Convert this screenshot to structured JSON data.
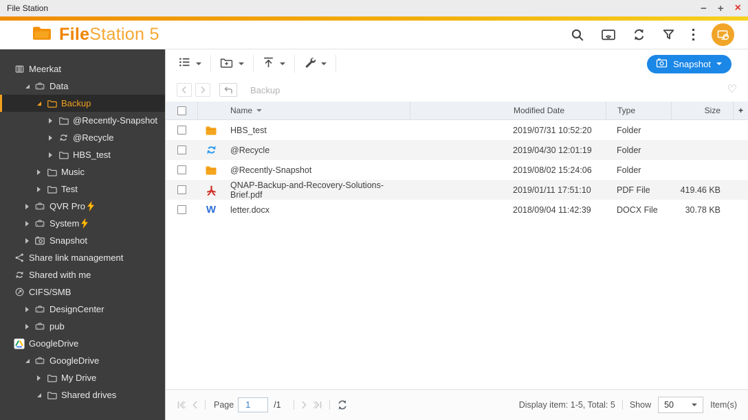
{
  "window": {
    "title": "File Station",
    "minimize": "−",
    "maximize": "+",
    "close": "×"
  },
  "header": {
    "logo_bold": "File",
    "logo_light": "Station 5"
  },
  "sidebar": {
    "items": [
      {
        "label": "Meerkat",
        "icon": "nas",
        "level": 0,
        "arrow": "none"
      },
      {
        "label": "Data",
        "icon": "drive",
        "level": 1,
        "arrow": "exp"
      },
      {
        "label": "Backup",
        "icon": "folder",
        "level": 2,
        "arrow": "exp",
        "selected": true
      },
      {
        "label": "@Recently-Snapshot",
        "icon": "folder",
        "level": 3,
        "arrow": "col"
      },
      {
        "label": "@Recycle",
        "icon": "sync",
        "level": 3,
        "arrow": "col"
      },
      {
        "label": "HBS_test",
        "icon": "folder",
        "level": 3,
        "arrow": "col"
      },
      {
        "label": "Music",
        "icon": "folder",
        "level": 2,
        "arrow": "col"
      },
      {
        "label": "Test",
        "icon": "folder",
        "level": 2,
        "arrow": "col"
      },
      {
        "label": "QVR Pro",
        "icon": "drive",
        "level": 1,
        "arrow": "col",
        "bolt": true
      },
      {
        "label": "System",
        "icon": "drive",
        "level": 1,
        "arrow": "col",
        "bolt": true
      },
      {
        "label": "Snapshot",
        "icon": "camera",
        "level": 1,
        "arrow": "col"
      },
      {
        "label": "Share link management",
        "icon": "share",
        "level": 0,
        "arrow": "none"
      },
      {
        "label": "Shared with me",
        "icon": "sync",
        "level": 0,
        "arrow": "none"
      },
      {
        "label": "CIFS/SMB",
        "icon": "network",
        "level": 0,
        "arrow": "none"
      },
      {
        "label": "DesignCenter",
        "icon": "drive",
        "level": 1,
        "arrow": "col"
      },
      {
        "label": "pub",
        "icon": "drive",
        "level": 1,
        "arrow": "col"
      },
      {
        "label": "GoogleDrive",
        "icon": "gdrive",
        "level": 0,
        "arrow": "none"
      },
      {
        "label": "GoogleDrive",
        "icon": "drive",
        "level": 1,
        "arrow": "exp"
      },
      {
        "label": "My Drive",
        "icon": "folder",
        "level": 2,
        "arrow": "col"
      },
      {
        "label": "Shared drives",
        "icon": "folder",
        "level": 2,
        "arrow": "exp"
      }
    ]
  },
  "toolbar": {
    "snapshot_label": "Snapshot"
  },
  "breadcrumb": {
    "path": "Backup"
  },
  "table": {
    "columns": {
      "name": "Name",
      "modified": "Modified Date",
      "type": "Type",
      "size": "Size",
      "add": "+"
    },
    "rows": [
      {
        "name": "HBS_test",
        "icon": "folder-fill",
        "modified": "2019/07/31 10:52:20",
        "type": "Folder",
        "size": ""
      },
      {
        "name": "@Recycle",
        "icon": "recycle-fill",
        "modified": "2019/04/30 12:01:19",
        "type": "Folder",
        "size": ""
      },
      {
        "name": "@Recently-Snapshot",
        "icon": "folder-fill",
        "modified": "2019/08/02 15:24:06",
        "type": "Folder",
        "size": ""
      },
      {
        "name": "QNAP-Backup-and-Recovery-Solutions-Brief.pdf",
        "icon": "pdf",
        "modified": "2019/01/11 17:51:10",
        "type": "PDF File",
        "size": "419.46 KB"
      },
      {
        "name": "letter.docx",
        "icon": "word",
        "modified": "2018/09/04 11:42:39",
        "type": "DOCX File",
        "size": "30.78 KB"
      }
    ]
  },
  "footer": {
    "page_label": "Page",
    "page_value": "1",
    "page_total": "/1",
    "display_text": "Display item: 1-5, Total: 5",
    "show_label": "Show",
    "page_size": "50",
    "items_label": "Item(s)"
  },
  "colors": {
    "accent_orange": "#f29104",
    "selected_orange": "#f0a01e",
    "gradient_yellow": "#f6d221",
    "snapshot_button_blue": "#1b87e6",
    "folder_icon": "#f5a61f",
    "recycle_icon_blue": "#2e9bf0",
    "pdf_icon_red": "#cf2e24",
    "word_icon_blue": "#2f6fd6",
    "sidebar_bg": "#3d3d3d",
    "close_red": "#e0352b"
  }
}
